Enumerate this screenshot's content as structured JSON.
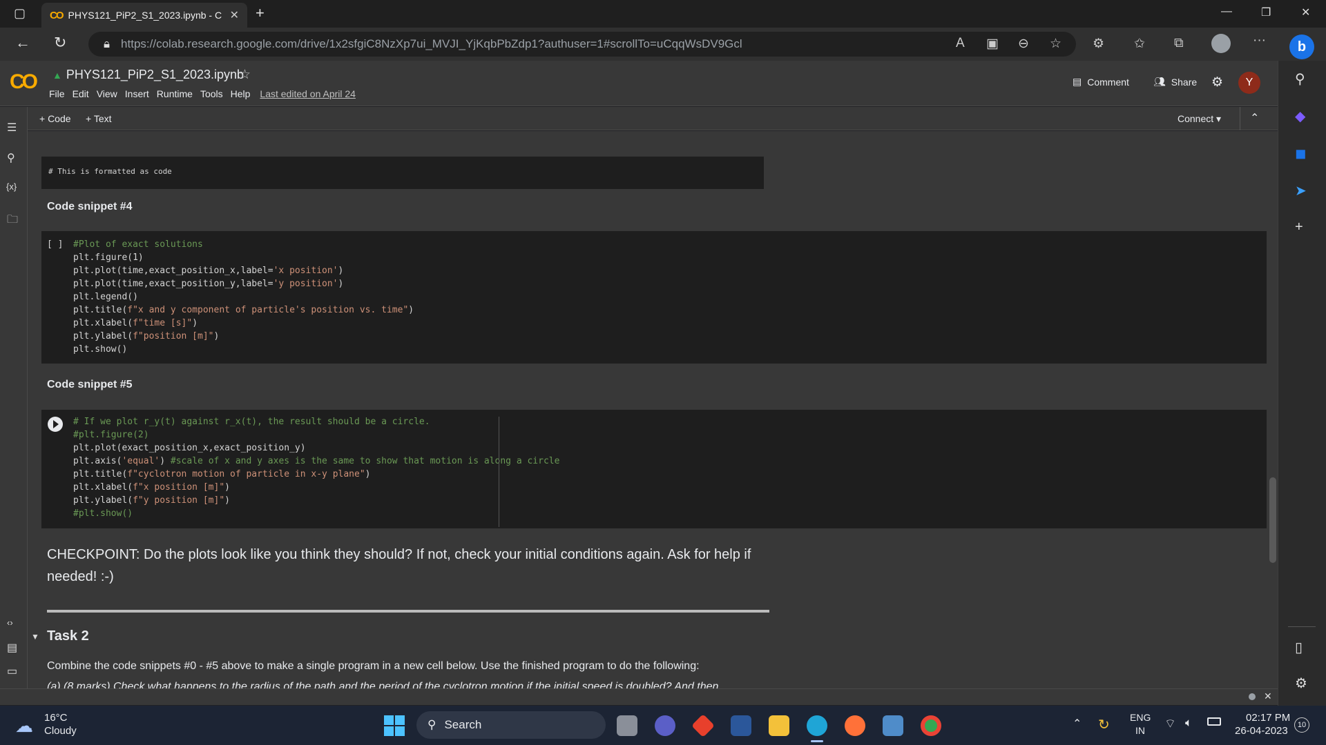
{
  "browser": {
    "tab_title": "PHYS121_PiP2_S1_2023.ipynb - C",
    "url_host": "https://colab.research.google.com",
    "url_path": "/drive/1x2sfgiC8NzXp7ui_MVJI_YjKqbPbZdp1?authuser=1#scrollTo=uCqqWsDV9Gcl"
  },
  "colab": {
    "logo": "CO",
    "filename": "PHYS121_PiP2_S1_2023.ipynb",
    "menu": [
      "File",
      "Edit",
      "View",
      "Insert",
      "Runtime",
      "Tools",
      "Help"
    ],
    "last_edited": "Last edited on April 24",
    "comment": "Comment",
    "share": "Share",
    "avatar": "Y",
    "add_code": "+ Code",
    "add_text": "+ Text",
    "connect": "Connect"
  },
  "cells": {
    "top_code": "# This is formatted as code",
    "snippet4_heading": "Code snippet #4",
    "snippet4_bracket": "[ ]",
    "snippet5_heading": "Code snippet #5",
    "checkpoint": "CHECKPOINT: Do the plots look like you think they should? If not, check your initial conditions again. Ask for help if needed! :-)",
    "task2_heading": "Task 2",
    "task2_text": "Combine the code snippets #0 - #5 above to make a single program in a new cell below. Use the finished program to do the following:",
    "task2_partial": "(a) (8 marks) Check what happens to the radius of the path and the period of the cyclotron motion if the initial speed is doubled? And then"
  },
  "taskbar": {
    "temp": "16°C",
    "weather": "Cloudy",
    "search": "Search",
    "lang1": "ENG",
    "lang2": "IN",
    "time": "02:17 PM",
    "date": "26-04-2023",
    "notif": "10"
  }
}
